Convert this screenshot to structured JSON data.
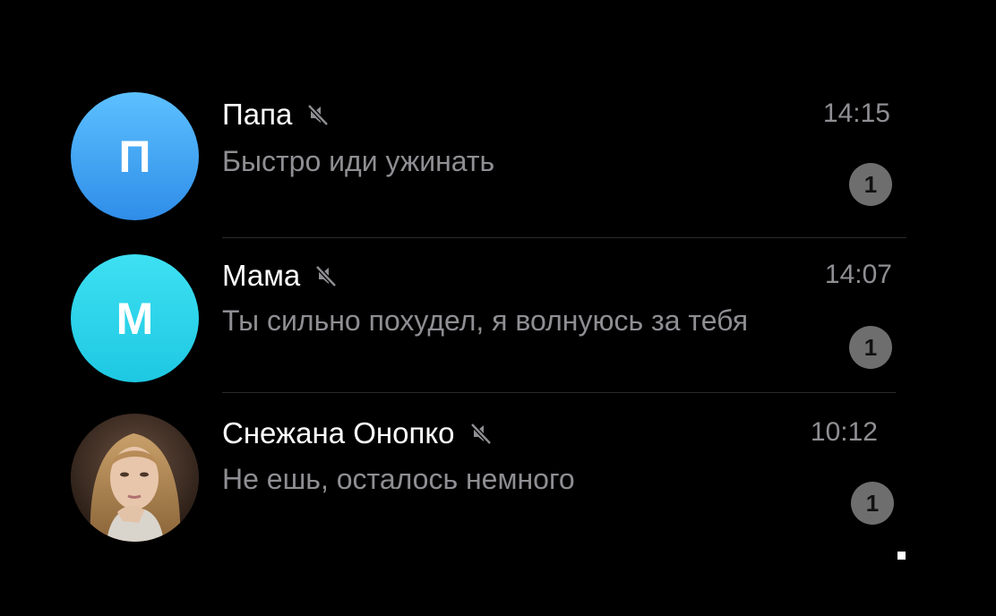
{
  "chats": [
    {
      "name": "Папа",
      "message": "Быстро иди ужинать",
      "time": "14:15",
      "unread": "1",
      "avatar_letter": "П",
      "avatar_color_top": "#5cc0ff",
      "avatar_color_bottom": "#2f8de8",
      "muted": true
    },
    {
      "name": "Мама",
      "message": "Ты сильно похудел, я волнуюсь за тебя",
      "time": "14:07",
      "unread": "1",
      "avatar_letter": "М",
      "avatar_color_top": "#3ee0f2",
      "avatar_color_bottom": "#1ec8e2",
      "muted": true
    },
    {
      "name": "Снежана Онопко",
      "message": "Не ешь, осталось немного",
      "time": "10:12",
      "unread": "1",
      "avatar_image": "portrait-photo",
      "muted": true
    }
  ],
  "colors": {
    "background": "#000000",
    "name": "#ffffff",
    "secondary_text": "#8e8e93",
    "badge": "#6e6e6e"
  },
  "icons": {
    "mute": "speaker-muted-icon"
  }
}
